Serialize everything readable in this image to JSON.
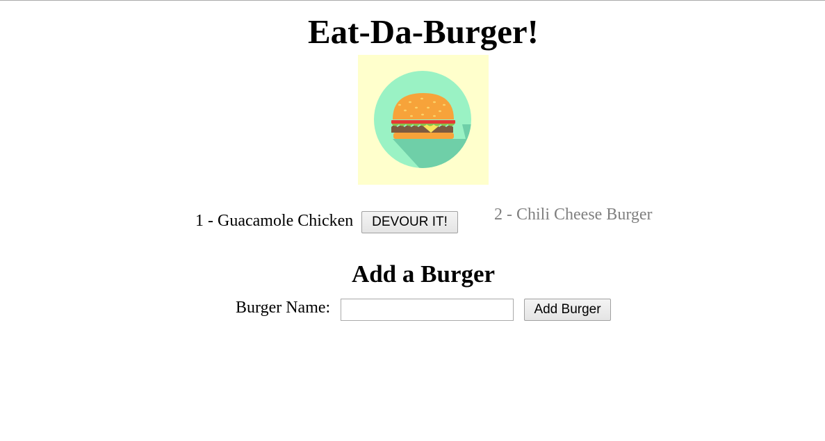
{
  "header": {
    "title": "Eat-Da-Burger!"
  },
  "logo": {
    "icon": "hamburger-icon",
    "background_color": "#ffffcc",
    "circle_color": "#9af2c4"
  },
  "burgers": {
    "uneaten": [
      {
        "label": "1 - Guacamole Chicken",
        "button_label": "DEVOUR IT!"
      }
    ],
    "devoured": [
      {
        "label": "2 - Chili Cheese Burger"
      }
    ]
  },
  "add_form": {
    "title": "Add a Burger",
    "label": "Burger Name:",
    "input_value": "",
    "input_placeholder": "",
    "submit_label": "Add Burger"
  }
}
